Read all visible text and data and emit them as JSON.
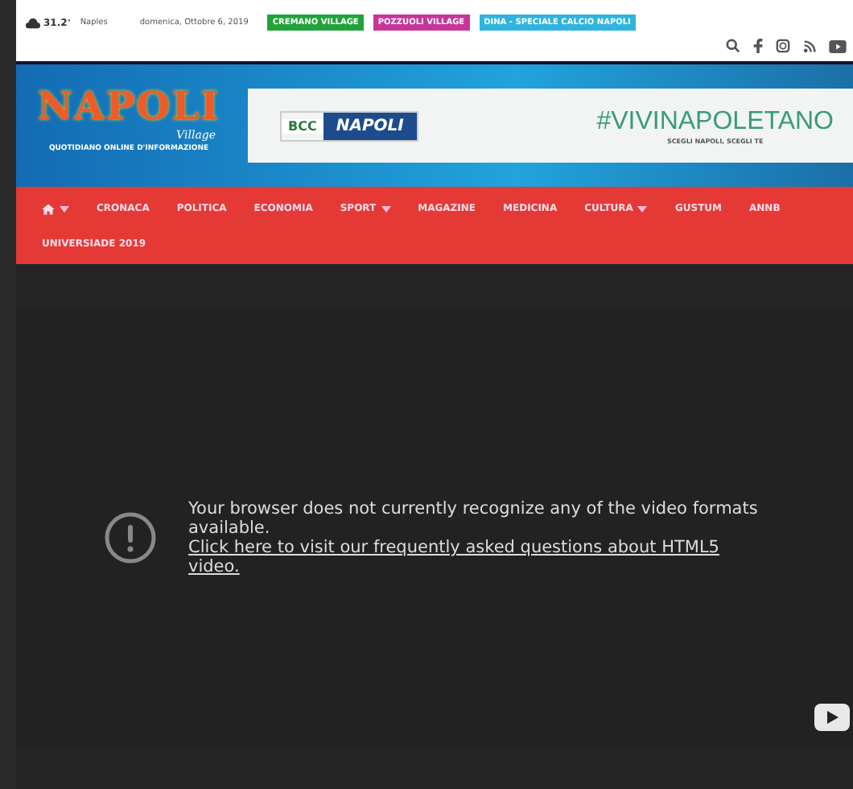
{
  "top_bar": {
    "weather": {
      "temperature": "31.2",
      "unit": "°",
      "city": "Naples"
    },
    "date": "domenica, Ottobre 6, 2019",
    "tags": [
      {
        "label": "CREMANO VILLAGE",
        "color": "#22a33a"
      },
      {
        "label": "POZZUOLI VILLAGE",
        "color": "#c8359a"
      },
      {
        "label": "DINA - SPECIALE CALCIO NAPOLI",
        "color": "#2fb4e0"
      }
    ]
  },
  "header": {
    "logo": {
      "name": "NAPOLI",
      "sub": "Village",
      "tagline": "QUOTIDIANO ONLINE D'INFORMAZIONE"
    },
    "banner": {
      "bank": "BCC",
      "bank_name": "NAPOLI",
      "hashtag": "#VIVINAPOLETANO",
      "slogan": "SCEGLI NAPOLI, SCEGLI TE"
    }
  },
  "nav": {
    "items": [
      {
        "kind": "home",
        "dropdown": true
      },
      {
        "label": "CRONACA",
        "kind": "text",
        "dropdown": false
      },
      {
        "label": "POLITICA",
        "kind": "text",
        "dropdown": false
      },
      {
        "label": "ECONOMIA",
        "kind": "text",
        "dropdown": false
      },
      {
        "label": "SPORT",
        "kind": "text",
        "dropdown": true
      },
      {
        "label": "MAGAZINE",
        "kind": "text",
        "dropdown": false
      },
      {
        "label": "MEDICINA",
        "kind": "text",
        "dropdown": false
      },
      {
        "label": "CULTURA",
        "kind": "text",
        "dropdown": true
      },
      {
        "label": "GUSTUM",
        "kind": "text",
        "dropdown": false
      },
      {
        "label": "ANNB",
        "kind": "text",
        "dropdown": false
      },
      {
        "label": "UNIVERSIADE 2019",
        "kind": "text",
        "dropdown": false
      }
    ]
  },
  "video": {
    "message": "Your browser does not currently recognize any of the video formats available.",
    "link": "Click here to visit our frequently asked questions about HTML5 video."
  }
}
